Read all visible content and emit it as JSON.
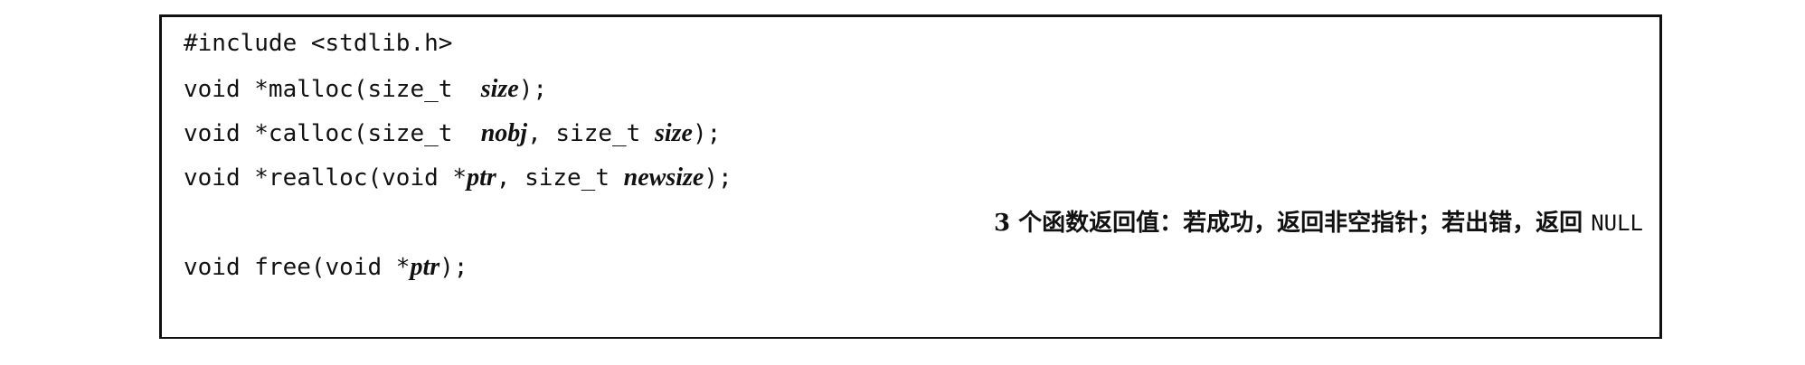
{
  "code": {
    "include": "#include <stdlib.h>",
    "malloc": {
      "prefix": "void *malloc(size_t  ",
      "arg1": "size",
      "suffix": ");"
    },
    "calloc": {
      "prefix": "void *calloc(size_t  ",
      "arg1": "nobj",
      "middle": ", size_t ",
      "arg2": "size",
      "suffix": ");"
    },
    "realloc": {
      "prefix": "void *realloc(void *",
      "arg1": "ptr",
      "middle": ", size_t ",
      "arg2": "newsize",
      "suffix": ");"
    },
    "return_note": {
      "text": "3 个函数返回值：若成功，返回非空指针；若出错，返回 ",
      "null": "NULL"
    },
    "free": {
      "prefix": "void free(void *",
      "arg1": "ptr",
      "suffix": ");"
    }
  }
}
